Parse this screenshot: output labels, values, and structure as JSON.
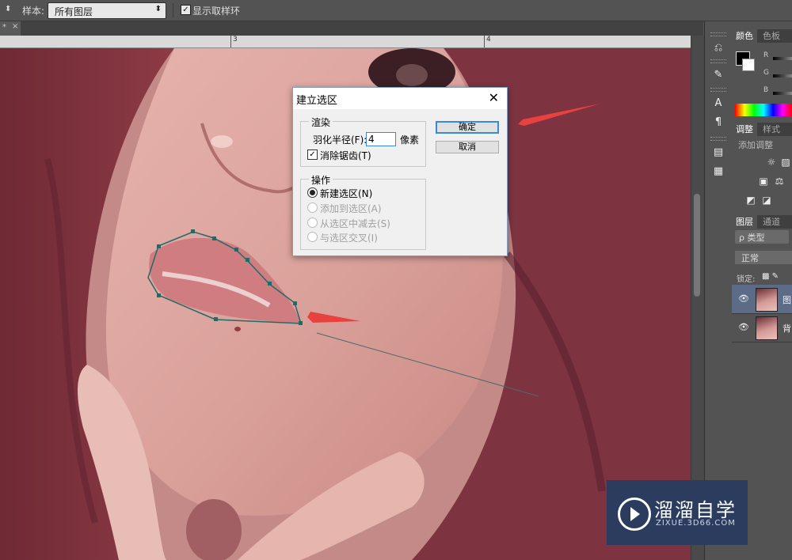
{
  "options_bar": {
    "sample_label": "样本:",
    "sample_value": "所有图层",
    "show_ring_label": "显示取样环",
    "show_ring_checked": true
  },
  "document_tab": {
    "label": "*",
    "close": "×"
  },
  "ruler": {
    "marks": [
      "3",
      "4"
    ]
  },
  "dialog": {
    "title": "建立选区",
    "close": "✕",
    "render_group": "渲染",
    "feather_label": "羽化半径(F):",
    "feather_value": "4",
    "feather_unit": "像素",
    "antialias_label": "消除锯齿(T)",
    "antialias_checked": true,
    "operation_group": "操作",
    "options": [
      {
        "label": "新建选区(N)",
        "selected": true,
        "enabled": true
      },
      {
        "label": "添加到选区(A)",
        "selected": false,
        "enabled": false
      },
      {
        "label": "从选区中减去(S)",
        "selected": false,
        "enabled": false
      },
      {
        "label": "与选区交叉(I)",
        "selected": false,
        "enabled": false
      }
    ],
    "ok": "确定",
    "cancel": "取消"
  },
  "panels": {
    "color_tabs": [
      "颜色",
      "色板"
    ],
    "channels": [
      "R",
      "G",
      "B"
    ],
    "adjust_tabs": [
      "调整",
      "样式"
    ],
    "add_adjustment": "添加调整",
    "layer_tabs": [
      "图层",
      "通道"
    ],
    "kind": "ρ 类型",
    "blend_mode": "正常",
    "lock_label": "锁定:",
    "layers": [
      {
        "name": "图",
        "selected": true
      },
      {
        "name": "背",
        "selected": false
      }
    ]
  },
  "watermark": {
    "name": "溜溜自学",
    "url": "ZIXUE.3D66.COM"
  },
  "colors": {
    "accent": "#3b8ad8",
    "arrow": "#e8413e",
    "path": "#1f6b66"
  }
}
